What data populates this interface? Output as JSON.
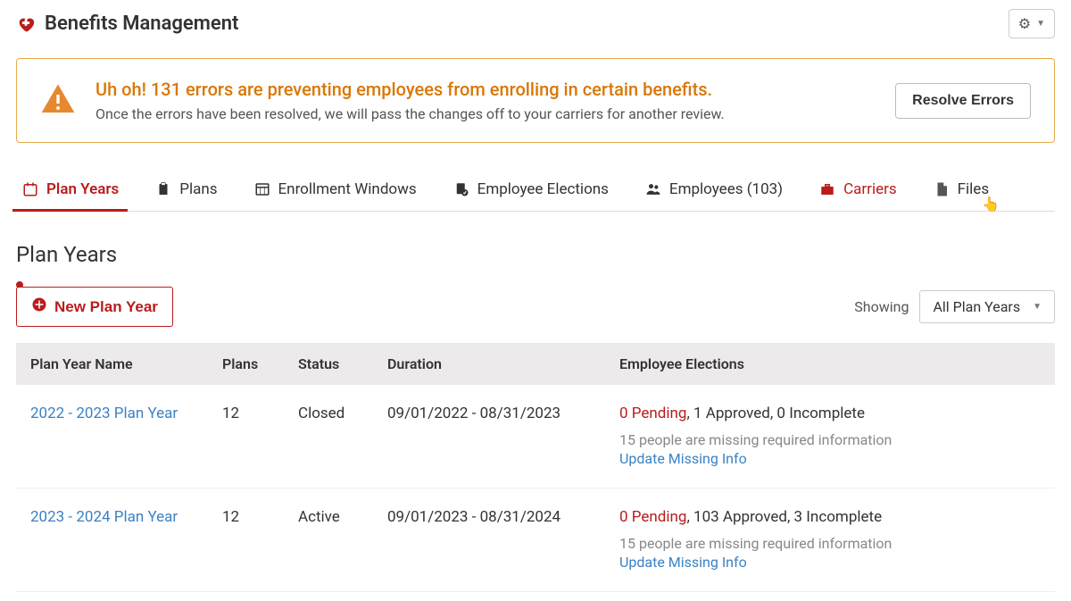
{
  "header": {
    "title": "Benefits Management"
  },
  "alert": {
    "title": "Uh oh! 131 errors are preventing employees from enrolling in certain benefits.",
    "subtitle": "Once the errors have been resolved, we will pass the changes off to your carriers for another review.",
    "resolve_label": "Resolve Errors"
  },
  "tabs": {
    "plan_years": "Plan Years",
    "plans": "Plans",
    "enrollment_windows": "Enrollment Windows",
    "employee_elections": "Employee Elections",
    "employees": "Employees (103)",
    "carriers": "Carriers",
    "files": "Files"
  },
  "section": {
    "title": "Plan Years",
    "new_button": "New Plan Year",
    "showing_label": "Showing",
    "filter_selected": "All Plan Years"
  },
  "table": {
    "columns": {
      "name": "Plan Year Name",
      "plans": "Plans",
      "status": "Status",
      "duration": "Duration",
      "elections": "Employee Elections"
    },
    "rows": [
      {
        "name": "2022 - 2023 Plan Year",
        "plans": "12",
        "status": "Closed",
        "duration": "09/01/2022 - 08/31/2023",
        "pending": "0 Pending",
        "approved_incomplete": ", 1 Approved, 0 Incomplete",
        "missing": "15 people are missing required information",
        "update_link": "Update Missing Info"
      },
      {
        "name": "2023 - 2024 Plan Year",
        "plans": "12",
        "status": "Active",
        "duration": "09/01/2023 - 08/31/2024",
        "pending": "0 Pending",
        "approved_incomplete": ", 103 Approved, 3 Incomplete",
        "missing": "15 people are missing required information",
        "update_link": "Update Missing Info"
      }
    ]
  }
}
